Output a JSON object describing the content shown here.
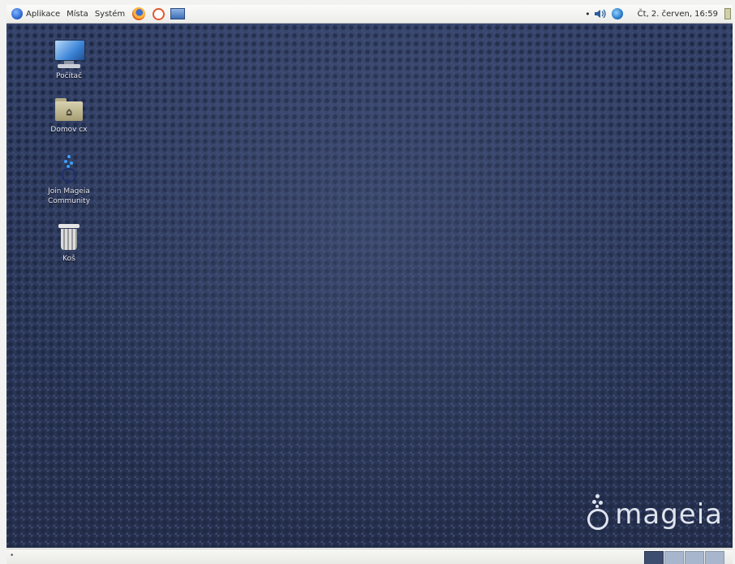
{
  "top_panel": {
    "menus": {
      "applications": "Aplikace",
      "places": "Místa",
      "system": "Systém"
    },
    "launchers": [
      {
        "icon": "firefox-icon"
      },
      {
        "icon": "mail-client-icon"
      },
      {
        "icon": "screen-icon"
      }
    ],
    "tray": {
      "volume_icon": "volume-icon",
      "network_icon": "network-icon"
    },
    "clock": "Čt, 2. červen, 16:59"
  },
  "desktop": {
    "icons": [
      {
        "label": "Počítač",
        "icon": "computer-icon"
      },
      {
        "label": "Domov cx",
        "icon": "home-folder-icon"
      },
      {
        "label": "Join Mageia Community",
        "icon": "join-community-icon"
      },
      {
        "label": "Koš",
        "icon": "trash-icon"
      }
    ],
    "logo": {
      "wordmark": "mageia"
    }
  },
  "bottom_panel": {
    "bullet": "•",
    "workspaces": 4,
    "active_workspace": 1
  }
}
